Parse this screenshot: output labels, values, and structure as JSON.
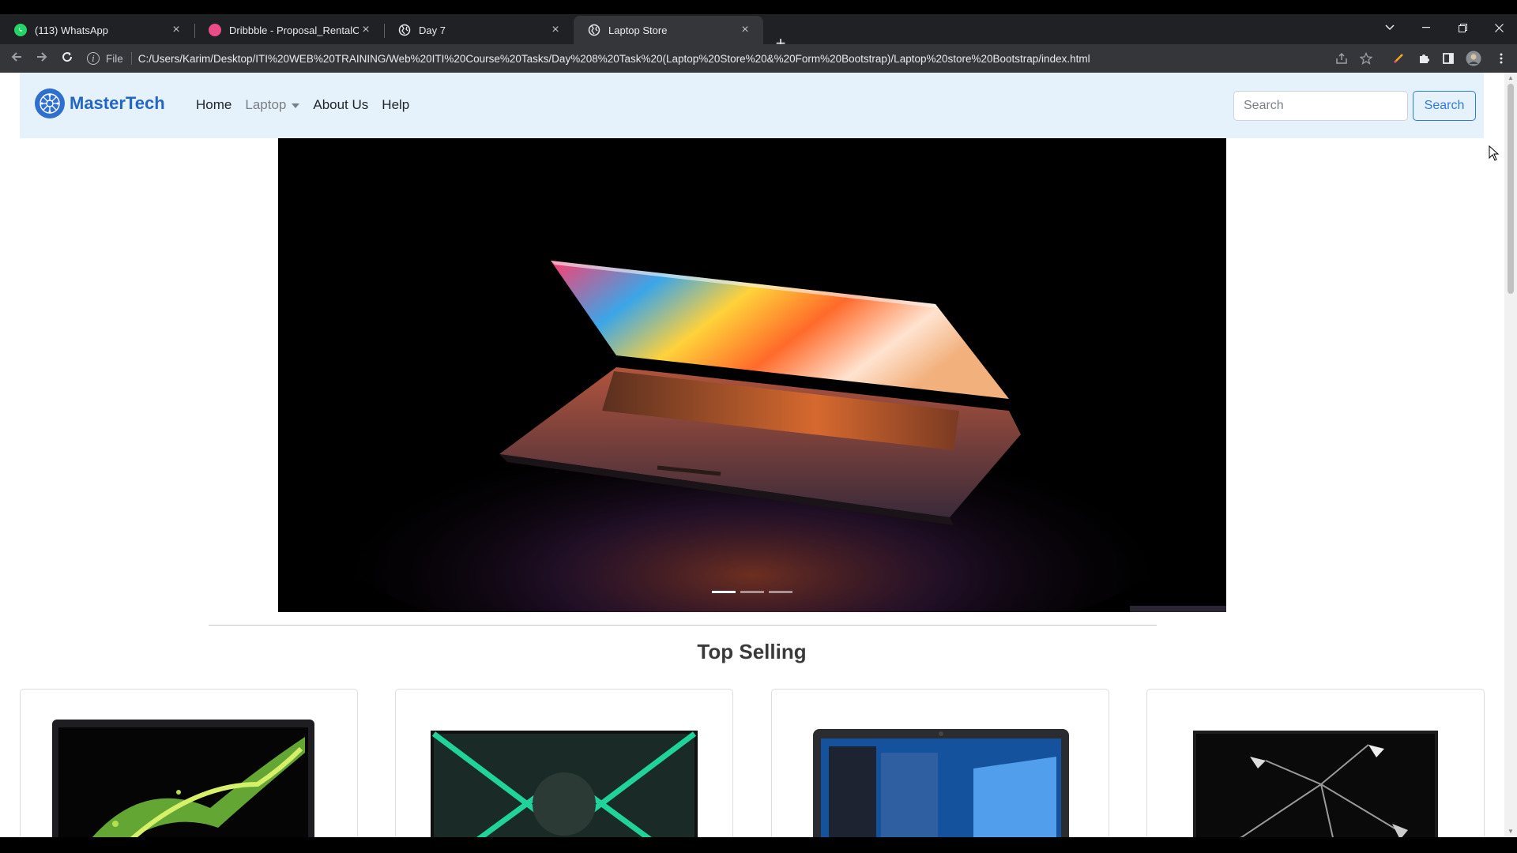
{
  "browser": {
    "tabs": [
      {
        "title": "(113) WhatsApp",
        "icon": "whatsapp-icon",
        "color": "#25d366"
      },
      {
        "title": "Dribbble - Proposal_RentalCar.png",
        "icon": "dribbble-icon",
        "color": "#ea4c89"
      },
      {
        "title": "Day 7",
        "icon": "globe-icon",
        "color": "#e8eaed"
      },
      {
        "title": "Laptop Store",
        "icon": "globe-icon",
        "color": "#e8eaed",
        "active": true
      }
    ],
    "address": {
      "scheme": "File",
      "url": "C:/Users/Karim/Desktop/ITI%20WEB%20TRAINING/Web%20ITI%20Course%20Tasks/Day%208%20Task%20(Laptop%20Store%20&%20Form%20Bootstrap)/Laptop%20store%20Bootstrap/index.html"
    }
  },
  "navbar": {
    "brand": "MasterTech",
    "links": [
      "Home",
      "Laptop",
      "About Us",
      "Help"
    ],
    "search_placeholder": "Search",
    "search_button": "Search"
  },
  "carousel": {
    "slide_count": 3,
    "active_index": 0
  },
  "section": {
    "title": "Top Selling"
  },
  "colors": {
    "brand": "#2366c4",
    "navbar_bg": "#e6f2fb",
    "primary": "#2f7be0"
  }
}
